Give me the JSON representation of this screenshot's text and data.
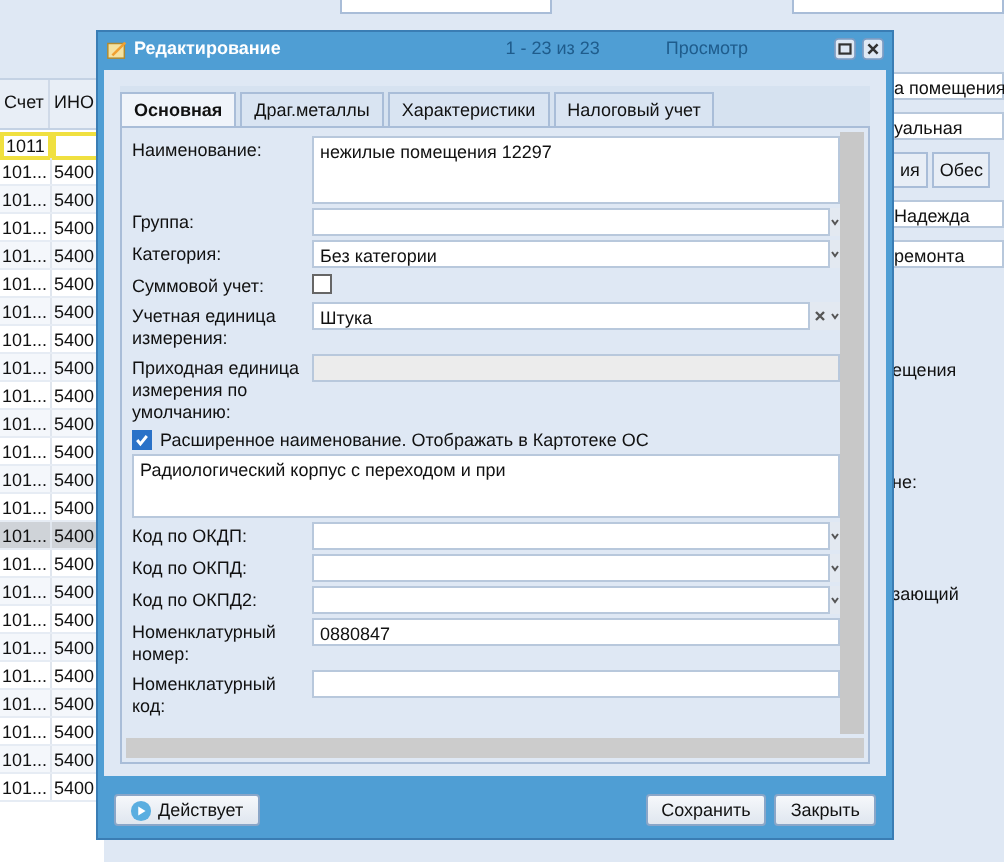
{
  "grid": {
    "columns": [
      "Счет",
      "ИНО"
    ],
    "filter": "1011",
    "rows": [
      {
        "c1": "101...",
        "c2": "5400",
        "selected": false
      },
      {
        "c1": "101...",
        "c2": "5400",
        "selected": false
      },
      {
        "c1": "101...",
        "c2": "5400",
        "selected": false
      },
      {
        "c1": "101...",
        "c2": "5400",
        "selected": false
      },
      {
        "c1": "101...",
        "c2": "5400",
        "selected": false
      },
      {
        "c1": "101...",
        "c2": "5400",
        "selected": false
      },
      {
        "c1": "101...",
        "c2": "5400",
        "selected": false
      },
      {
        "c1": "101...",
        "c2": "5400",
        "selected": false
      },
      {
        "c1": "101...",
        "c2": "5400",
        "selected": false
      },
      {
        "c1": "101...",
        "c2": "5400",
        "selected": false
      },
      {
        "c1": "101...",
        "c2": "5400",
        "selected": false
      },
      {
        "c1": "101...",
        "c2": "5400",
        "selected": false
      },
      {
        "c1": "101...",
        "c2": "5400",
        "selected": false
      },
      {
        "c1": "101...",
        "c2": "5400",
        "selected": true
      },
      {
        "c1": "101...",
        "c2": "5400",
        "selected": false
      },
      {
        "c1": "101...",
        "c2": "5400",
        "selected": false
      },
      {
        "c1": "101...",
        "c2": "5400",
        "selected": false
      },
      {
        "c1": "101...",
        "c2": "5400",
        "selected": false
      },
      {
        "c1": "101...",
        "c2": "5400",
        "selected": false
      },
      {
        "c1": "101...",
        "c2": "5400",
        "selected": false
      },
      {
        "c1": "101...",
        "c2": "5400",
        "selected": false
      },
      {
        "c1": "101...",
        "c2": "5400",
        "selected": false
      },
      {
        "c1": "101...",
        "c2": "5400",
        "selected": false
      }
    ]
  },
  "pager": "1 - 23 из 23",
  "view_title": "Просмотр",
  "right_panel": [
    {
      "kind": "field",
      "text": "а помещения"
    },
    {
      "kind": "field",
      "text": "уальная"
    },
    {
      "kind": "tabs",
      "tabs": [
        "ия",
        "Обес"
      ]
    },
    {
      "kind": "field",
      "text": "Надежда"
    },
    {
      "kind": "field",
      "text": "ремонта"
    },
    {
      "kind": "label",
      "text": "ещения"
    },
    {
      "kind": "label",
      "text": "не:"
    },
    {
      "kind": "label",
      "text": "зающий"
    }
  ],
  "dialog": {
    "title": "Редактирование",
    "tabs": [
      {
        "label": "Основная",
        "selected": true
      },
      {
        "label": "Драг.металлы",
        "selected": false
      },
      {
        "label": "Характеристики",
        "selected": false
      },
      {
        "label": "Налоговый учет",
        "selected": false
      }
    ],
    "fields": [
      {
        "kind": "textarea",
        "label": "Наименование:",
        "value": "нежилые помещения 12297"
      },
      {
        "kind": "combo",
        "label": "Группа:"
      },
      {
        "kind": "combo",
        "label": "Категория:",
        "value": "Без категории"
      },
      {
        "kind": "checkbox",
        "label": "Суммовой учет:",
        "checked": false
      },
      {
        "kind": "combo",
        "label": "Учетная единица измерения:",
        "value": "Штука",
        "clear": true
      },
      {
        "kind": "disabled",
        "label": "Приходная единица измерения по умолчанию:"
      },
      {
        "kind": "wide-checkbox",
        "label": "Расширенное наименование. Отображать в Картотеке ОС",
        "checked": true
      },
      {
        "kind": "wide-textarea",
        "value": "Радиологический корпус с переходом и при"
      },
      {
        "kind": "combo",
        "label": "Код по ОКДП:"
      },
      {
        "kind": "combo",
        "label": "Код по ОКПД:"
      },
      {
        "kind": "combo",
        "label": "Код по ОКПД2:"
      },
      {
        "kind": "text",
        "label": "Номенклатурный номер:",
        "value": "0880847"
      },
      {
        "kind": "text",
        "label": "Номенклатурный код:"
      }
    ],
    "status_button": "Действует",
    "buttons": [
      "Сохранить",
      "Закрыть"
    ]
  }
}
